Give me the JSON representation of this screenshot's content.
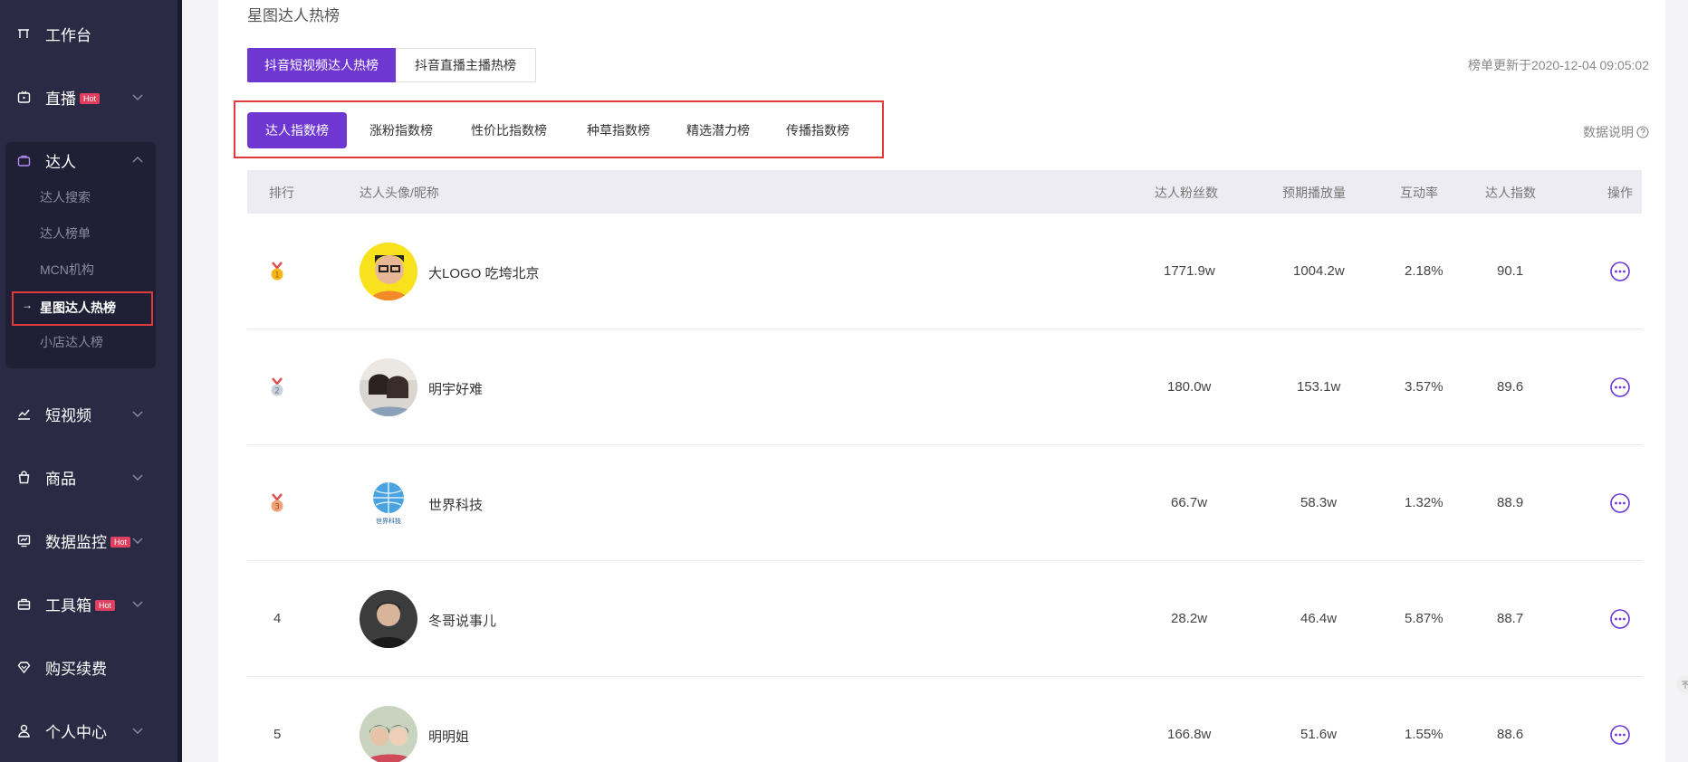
{
  "sidebar": {
    "items": [
      {
        "label": "工作台",
        "icon": "workbench-icon",
        "hot": false,
        "chevron": false
      },
      {
        "label": "直播",
        "icon": "live-icon",
        "hot": true,
        "chevron": true
      },
      {
        "label": "达人",
        "icon": "talent-icon",
        "hot": false,
        "chevron": true,
        "expanded": true
      },
      {
        "label": "短视频",
        "icon": "video-icon",
        "hot": false,
        "chevron": true
      },
      {
        "label": "商品",
        "icon": "shopping-bag-icon",
        "hot": false,
        "chevron": true
      },
      {
        "label": "数据监控",
        "icon": "monitor-icon",
        "hot": true,
        "chevron": true
      },
      {
        "label": "工具箱",
        "icon": "toolbox-icon",
        "hot": true,
        "chevron": true
      },
      {
        "label": "购买续费",
        "icon": "diamond-icon",
        "hot": false,
        "chevron": false
      },
      {
        "label": "个人中心",
        "icon": "user-icon",
        "hot": false,
        "chevron": true
      }
    ],
    "hot_label": "Hot",
    "subitems": [
      "达人搜索",
      "达人榜单",
      "MCN机构",
      "星图达人热榜",
      "小店达人榜"
    ],
    "active_subitem": "星图达人热榜"
  },
  "main": {
    "title": "星图达人热榜",
    "primary_tabs": [
      "抖音短视频达人热榜",
      "抖音直播主播热榜"
    ],
    "update_time": "榜单更新于2020-12-04 09:05:02",
    "sub_tabs": [
      "达人指数榜",
      "涨粉指数榜",
      "性价比指数榜",
      "种草指数榜",
      "精选潜力榜",
      "传播指数榜"
    ],
    "data_explain": "数据说明",
    "table": {
      "headers": {
        "rank": "排行",
        "avatar_name": "达人头像/昵称",
        "fans": "达人粉丝数",
        "plays": "预期播放量",
        "interaction": "互动率",
        "index": "达人指数",
        "action": "操作"
      },
      "rows": [
        {
          "rank": "1",
          "name": "大LOGO 吃垮北京",
          "fans": "1771.9w",
          "plays": "1004.2w",
          "interaction": "2.18%",
          "index": "90.1"
        },
        {
          "rank": "2",
          "name": "明宇好难",
          "fans": "180.0w",
          "plays": "153.1w",
          "interaction": "3.57%",
          "index": "89.6"
        },
        {
          "rank": "3",
          "name": "世界科技",
          "fans": "66.7w",
          "plays": "58.3w",
          "interaction": "1.32%",
          "index": "88.9"
        },
        {
          "rank": "4",
          "name": "冬哥说事儿",
          "fans": "28.2w",
          "plays": "46.4w",
          "interaction": "5.87%",
          "index": "88.7"
        },
        {
          "rank": "5",
          "name": "明明姐",
          "fans": "166.8w",
          "plays": "51.6w",
          "interaction": "1.55%",
          "index": "88.6"
        }
      ]
    }
  },
  "colors": {
    "accent": "#6f37d1",
    "sidebar_bg": "#2a2a44",
    "highlight_border": "#e03a3a",
    "hot": "#e0405e"
  }
}
